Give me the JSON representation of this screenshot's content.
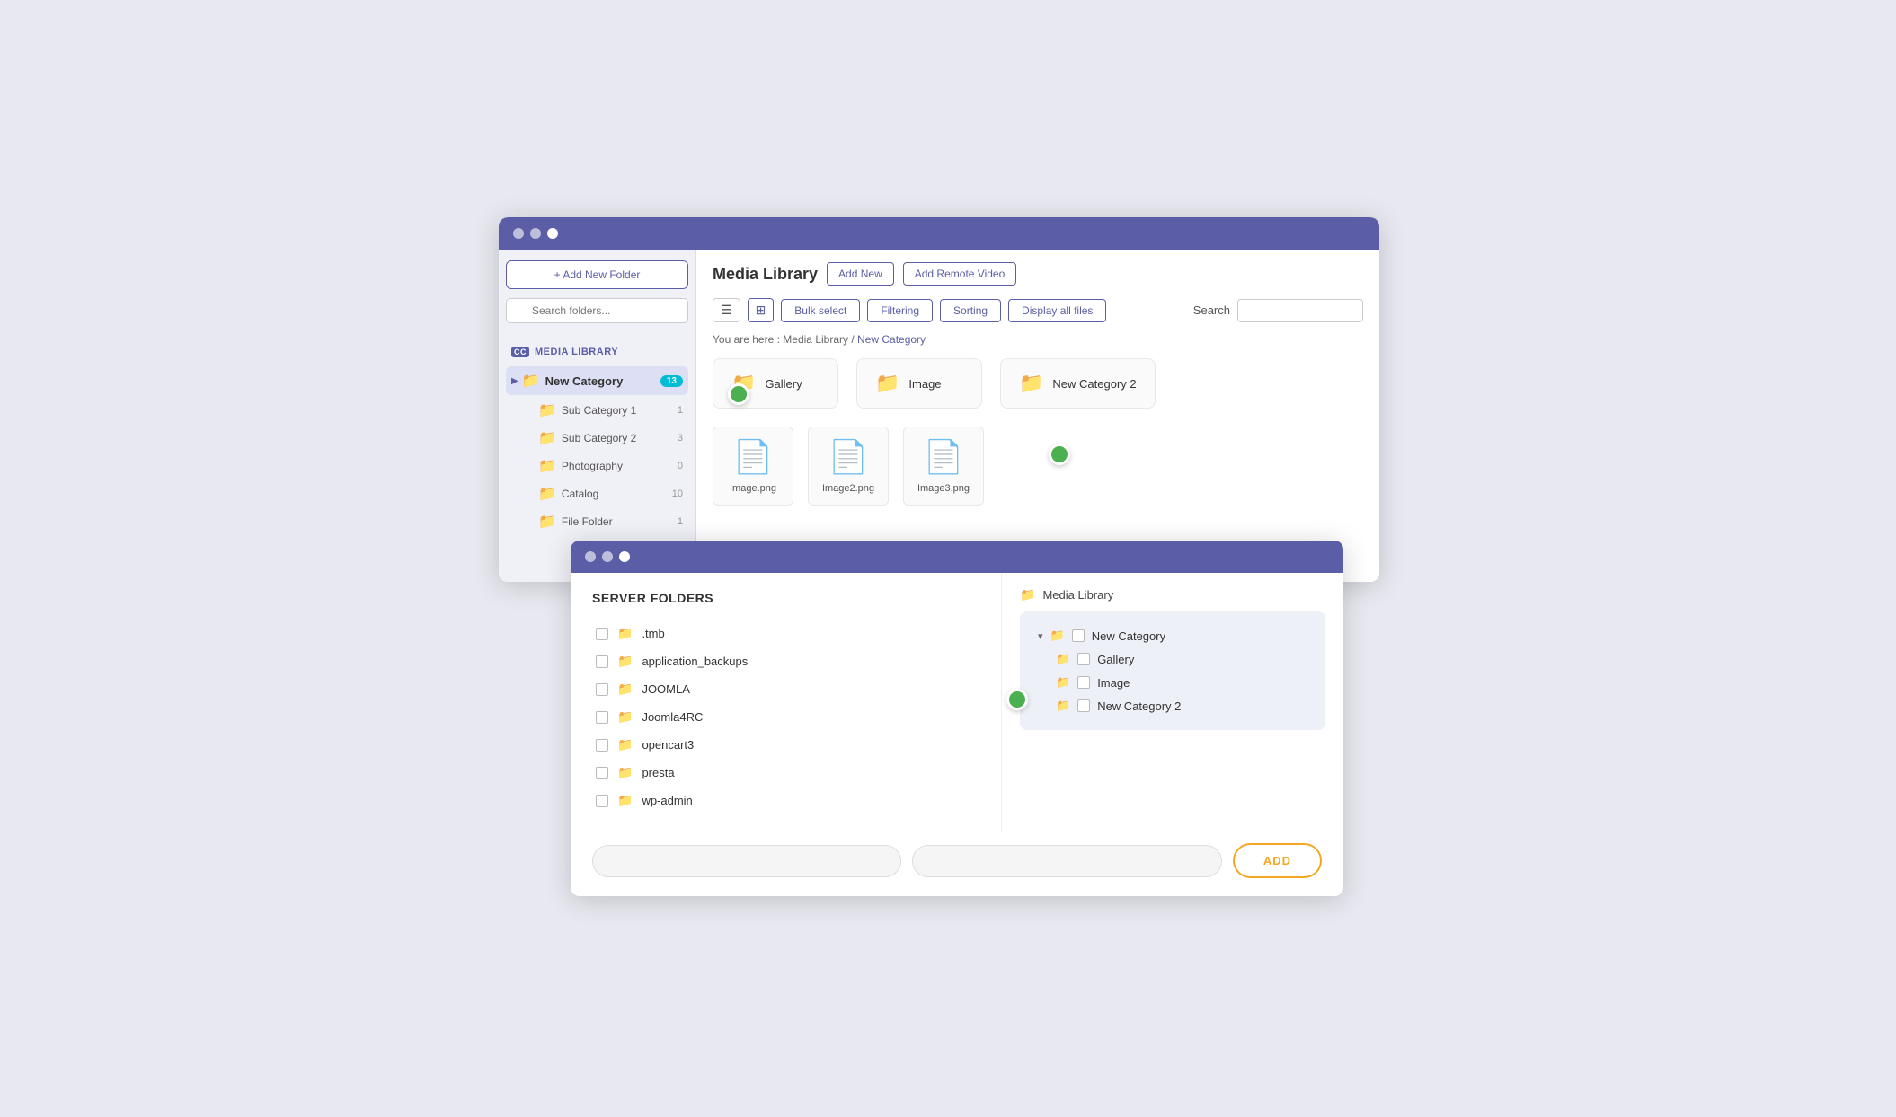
{
  "window_main": {
    "titlebar_dots": [
      "dot1",
      "dot2",
      "dot3"
    ],
    "sidebar": {
      "add_folder_btn": "+ Add New Folder",
      "search_placeholder": "Search folders...",
      "media_library_label": "MEDIA LIBRARY",
      "new_category": {
        "name": "New Category",
        "badge": "13",
        "subfolders": [
          {
            "name": "Sub Category 1",
            "count": "1"
          },
          {
            "name": "Sub Category 2",
            "count": "3"
          },
          {
            "name": "Photography",
            "count": "0"
          },
          {
            "name": "Catalog",
            "count": "10"
          },
          {
            "name": "File Folder",
            "count": "1"
          }
        ]
      }
    },
    "content": {
      "title": "Media Library",
      "add_new_btn": "Add New",
      "add_remote_video_btn": "Add Remote Video",
      "bulk_select_btn": "Bulk select",
      "filtering_btn": "Filtering",
      "sorting_btn": "Sorting",
      "display_all_btn": "Display all files",
      "search_label": "Search",
      "breadcrumb": {
        "prefix": "You are here :",
        "library": "Media Library",
        "separator": "/",
        "current": "New Category"
      },
      "folders": [
        {
          "name": "Gallery",
          "color": "gray"
        },
        {
          "name": "Image",
          "color": "gray"
        },
        {
          "name": "New Category 2",
          "color": "orange"
        }
      ],
      "files": [
        {
          "name": "Image.png"
        },
        {
          "name": "Image2.png"
        },
        {
          "name": "Image3.png"
        }
      ]
    }
  },
  "window_server": {
    "title": "SERVER FOLDERS",
    "items": [
      {
        "name": ".tmb"
      },
      {
        "name": "application_backups"
      },
      {
        "name": "JOOMLA"
      },
      {
        "name": "Joomla4RC"
      },
      {
        "name": "opencart3"
      },
      {
        "name": "presta"
      },
      {
        "name": "wp-admin"
      }
    ],
    "right_panel": {
      "media_library": "Media Library",
      "tree": {
        "root": "New Category",
        "items": [
          {
            "name": "Gallery",
            "indent": false
          },
          {
            "name": "Image",
            "indent": false
          },
          {
            "name": "New Category 2",
            "indent": false
          }
        ]
      }
    },
    "add_input_placeholder": "",
    "add_btn": "ADD"
  }
}
